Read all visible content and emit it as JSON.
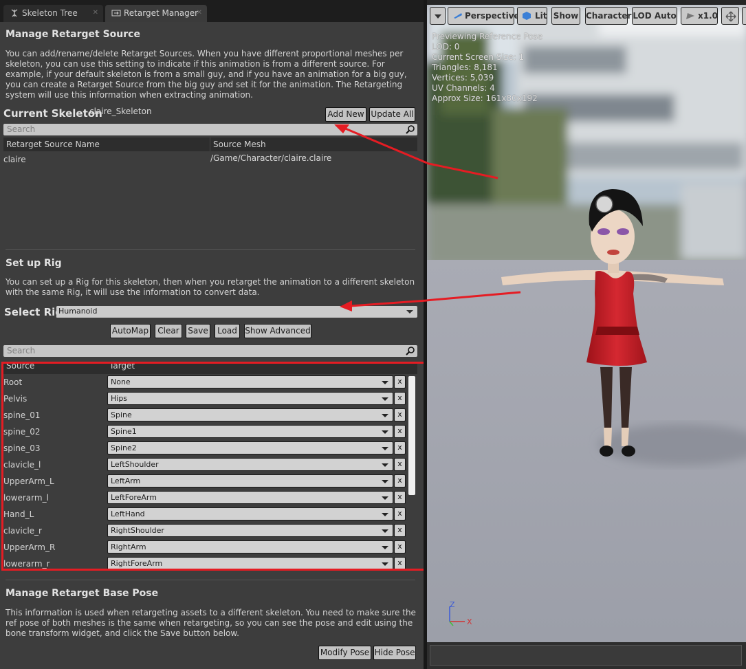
{
  "tabs": [
    {
      "label": "Skeleton Tree",
      "active": false
    },
    {
      "label": "Retarget Manager",
      "active": true
    }
  ],
  "retarget_source": {
    "heading": "Manage Retarget Source",
    "description": "You can add/rename/delete Retarget Sources. When you have different proportional meshes per skeleton, you can use this setting to indicate if this animation is from a different source. For example, if your default skeleton is from a small guy, and if you have an animation for a big guy, you can create a Retarget Source from the big guy and set it for the animation. The Retargeting system will use this information when extracting animation.",
    "current_skeleton_label": "Current Skeleton",
    "current_skeleton_value": "claire_Skeleton",
    "add_new_label": "Add New",
    "update_all_label": "Update All",
    "search_placeholder": "Search",
    "columns": [
      "Retarget Source Name",
      "Source Mesh"
    ],
    "rows": [
      {
        "name": "claire",
        "mesh": "/Game/Character/claire.claire"
      }
    ]
  },
  "rig": {
    "heading": "Set up Rig",
    "description": "You can set up a Rig for this skeleton, then when you retarget the animation to a different skeleton with the same Rig, it will use the information to convert data.",
    "select_label": "Select Rig",
    "selected_rig": "Humanoid",
    "buttons": [
      "AutoMap",
      "Clear",
      "Save",
      "Load",
      "Show Advanced"
    ],
    "search_placeholder": "Search",
    "columns": [
      "Source",
      "Target"
    ],
    "mappings": [
      {
        "source": "Root",
        "target": "None"
      },
      {
        "source": "Pelvis",
        "target": "Hips"
      },
      {
        "source": "spine_01",
        "target": "Spine"
      },
      {
        "source": "spine_02",
        "target": "Spine1"
      },
      {
        "source": "spine_03",
        "target": "Spine2"
      },
      {
        "source": "clavicle_l",
        "target": "LeftShoulder"
      },
      {
        "source": "UpperArm_L",
        "target": "LeftArm"
      },
      {
        "source": "lowerarm_l",
        "target": "LeftForeArm"
      },
      {
        "source": "Hand_L",
        "target": "LeftHand"
      },
      {
        "source": "clavicle_r",
        "target": "RightShoulder"
      },
      {
        "source": "UpperArm_R",
        "target": "RightArm"
      },
      {
        "source": "lowerarm_r",
        "target": "RightForeArm"
      }
    ],
    "clear_label": "x"
  },
  "base_pose": {
    "heading": "Manage Retarget Base Pose",
    "description": "This information is used when retargeting assets to a different skeleton. You need to make sure the ref pose of both meshes is the same when retargeting, so you can see the pose and edit using the bone transform widget, and click the Save button below.",
    "modify_label": "Modify Pose",
    "hide_label": "Hide Pose"
  },
  "viewport": {
    "toolbar": {
      "perspective": "Perspective",
      "lit": "Lit",
      "show": "Show",
      "character": "Character",
      "lod": "LOD Auto",
      "scale": "x1.0"
    },
    "stats": [
      "Previewing Reference Pose",
      "LOD: 0",
      "Current Screen Size: 1",
      "Triangles: 8,181",
      "Vertices: 5,039",
      "UV Channels: 4",
      "Approx Size: 161x80x192"
    ],
    "axis_labels": {
      "z": "Z",
      "x": "X"
    }
  },
  "colors": {
    "annotation_red": "#e51c23",
    "panel_bg": "#3d3d3d",
    "dress_red": "#c7232a"
  }
}
